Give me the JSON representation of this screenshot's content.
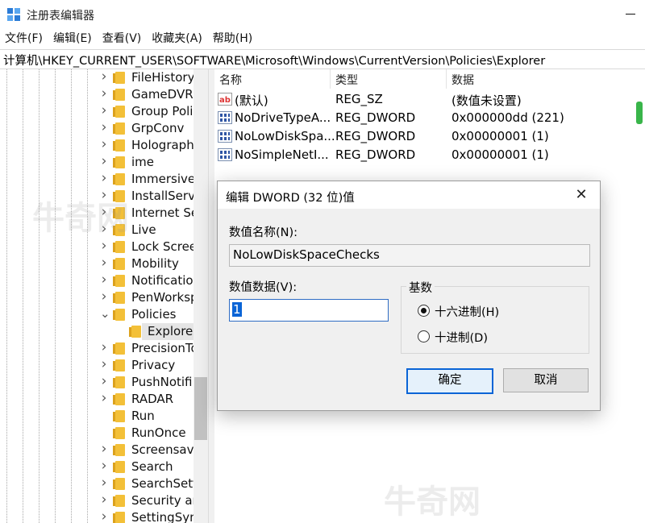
{
  "window": {
    "title": "注册表编辑器"
  },
  "menu": [
    "文件(F)",
    "编辑(E)",
    "查看(V)",
    "收藏夹(A)",
    "帮助(H)"
  ],
  "address": "计算机\\HKEY_CURRENT_USER\\SOFTWARE\\Microsoft\\Windows\\CurrentVersion\\Policies\\Explorer",
  "tree": {
    "items": [
      {
        "label": "FileHistory",
        "expand": "collapsed"
      },
      {
        "label": "GameDVR",
        "expand": "collapsed"
      },
      {
        "label": "Group Poli",
        "expand": "collapsed"
      },
      {
        "label": "GrpConv",
        "expand": "collapsed"
      },
      {
        "label": "Holograph",
        "expand": "collapsed"
      },
      {
        "label": "ime",
        "expand": "collapsed"
      },
      {
        "label": "Immersive",
        "expand": "collapsed"
      },
      {
        "label": "InstallServi",
        "expand": "collapsed"
      },
      {
        "label": "Internet Se",
        "expand": "collapsed"
      },
      {
        "label": "Live",
        "expand": "collapsed"
      },
      {
        "label": "Lock Scree",
        "expand": "collapsed"
      },
      {
        "label": "Mobility",
        "expand": "collapsed"
      },
      {
        "label": "Notificatio",
        "expand": "collapsed"
      },
      {
        "label": "PenWorksp",
        "expand": "collapsed"
      },
      {
        "label": "Policies",
        "expand": "expanded"
      },
      {
        "label": "Explorer",
        "expand": "none",
        "child": true,
        "selected": true
      },
      {
        "label": "PrecisionTo",
        "expand": "collapsed"
      },
      {
        "label": "Privacy",
        "expand": "collapsed"
      },
      {
        "label": "PushNotifi",
        "expand": "collapsed"
      },
      {
        "label": "RADAR",
        "expand": "collapsed"
      },
      {
        "label": "Run",
        "expand": "none"
      },
      {
        "label": "RunOnce",
        "expand": "none"
      },
      {
        "label": "Screensave",
        "expand": "collapsed"
      },
      {
        "label": "Search",
        "expand": "collapsed"
      },
      {
        "label": "SearchSett",
        "expand": "collapsed"
      },
      {
        "label": "Security ar",
        "expand": "collapsed"
      },
      {
        "label": "SettingSyn",
        "expand": "collapsed"
      }
    ]
  },
  "values_pane": {
    "columns": [
      "名称",
      "类型",
      "数据"
    ],
    "rows": [
      {
        "name": "(默认)",
        "type": "REG_SZ",
        "data": "(数值未设置)",
        "icon": "string-value-icon"
      },
      {
        "name": "NoDriveTypeA...",
        "type": "REG_DWORD",
        "data": "0x000000dd (221)",
        "icon": "dword-value-icon"
      },
      {
        "name": "NoLowDiskSpa...",
        "type": "REG_DWORD",
        "data": "0x00000001 (1)",
        "icon": "dword-value-icon"
      },
      {
        "name": "NoSimpleNetI...",
        "type": "REG_DWORD",
        "data": "0x00000001 (1)",
        "icon": "dword-value-icon"
      }
    ]
  },
  "dialog": {
    "title": "编辑 DWORD (32 位)值",
    "name_label": "数值名称(N):",
    "name_value": "NoLowDiskSpaceChecks",
    "data_label": "数值数据(V):",
    "data_value": "1",
    "base_label": "基数",
    "radio_hex": "十六进制(H)",
    "radio_dec": "十进制(D)",
    "selected_base": "hex",
    "ok": "确定",
    "cancel": "取消"
  },
  "watermark": {
    "text": "牛奇网"
  }
}
